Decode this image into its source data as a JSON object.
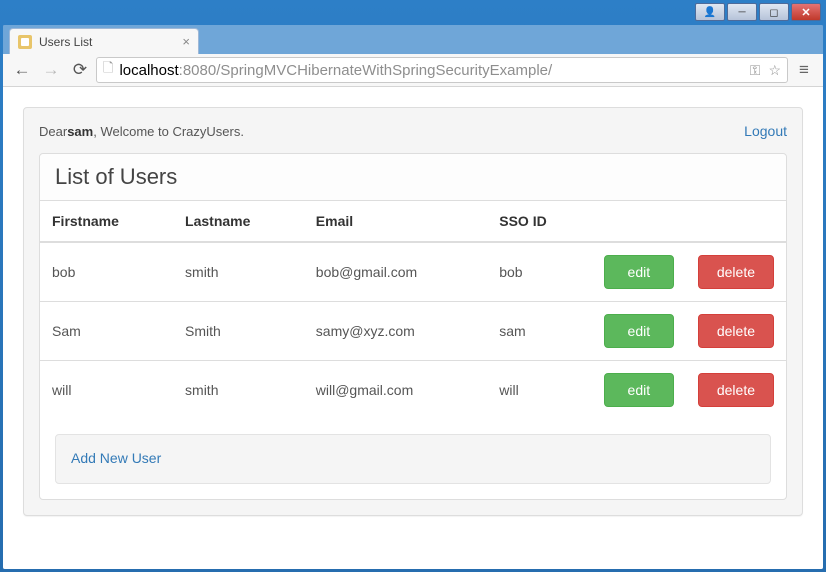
{
  "window": {
    "tab_title": "Users List"
  },
  "browser": {
    "url_host": "localhost",
    "url_port": ":8080",
    "url_path": "/SpringMVCHibernateWithSpringSecurityExample/"
  },
  "greeting": {
    "prefix": "Dear ",
    "username": "sam",
    "suffix": ", Welcome to CrazyUsers.",
    "logout_label": "Logout"
  },
  "panel": {
    "heading": "List of Users"
  },
  "columns": {
    "firstname": "Firstname",
    "lastname": "Lastname",
    "email": "Email",
    "ssoid": "SSO ID"
  },
  "actions": {
    "edit": "edit",
    "delete": "delete"
  },
  "users": [
    {
      "firstname": "bob",
      "lastname": "smith",
      "email": "bob@gmail.com",
      "ssoid": "bob"
    },
    {
      "firstname": "Sam",
      "lastname": "Smith",
      "email": "samy@xyz.com",
      "ssoid": "sam"
    },
    {
      "firstname": "will",
      "lastname": "smith",
      "email": "will@gmail.com",
      "ssoid": "will"
    }
  ],
  "footer": {
    "add_user_label": "Add New User"
  }
}
